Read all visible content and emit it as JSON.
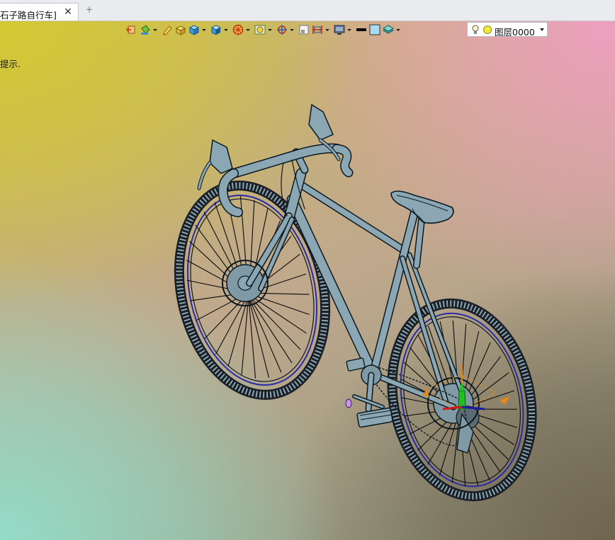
{
  "tab": {
    "title": "石子路自行车]",
    "close_glyph": "✕"
  },
  "new_tab_glyph": "+",
  "viewport": {
    "hint_text": "提示."
  },
  "toolbar": {
    "buttons": [
      "exit-sketch-icon",
      "paint-bucket-icon",
      "pencil-icon",
      "cube-yellow-icon",
      "cube-blue-icon",
      "section-cube-icon",
      "wheel-view-icon",
      "render-mode-icon",
      "target-icon",
      "frame-icon",
      "measure-icon",
      "monitor-icon",
      "line-style-icon",
      "color-swatch-icon",
      "layer-stack-icon"
    ],
    "layer": {
      "label": "图层0000"
    }
  },
  "colors": {
    "frame": "#8aa7b3",
    "outline": "#0c1820",
    "spoke": "#0a0a0a",
    "tire": "#1a1f26",
    "rim_accent": "#2a2ba6",
    "axis_x": "#d01818",
    "axis_y": "#20c020",
    "axis_z": "#e08a18"
  }
}
